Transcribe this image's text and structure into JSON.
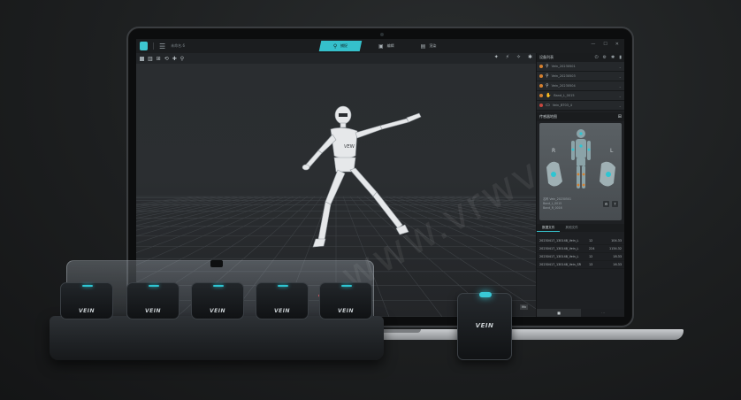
{
  "app": {
    "file_name": "未命名.6",
    "tabs": [
      {
        "label": "捕捉",
        "active": true
      },
      {
        "label": "编辑",
        "active": false
      },
      {
        "label": "渲染",
        "active": false
      }
    ]
  },
  "panel": {
    "devices_title": "设备列表",
    "devices": [
      {
        "name": "Vein_20230501",
        "status": "orange"
      },
      {
        "name": "Vein_20230503",
        "status": "orange"
      },
      {
        "name": "Vein_20230504",
        "status": "orange"
      },
      {
        "name": "Band_L_0015",
        "status": "orange"
      },
      {
        "name": "Vein_BT03_4",
        "status": "red"
      }
    ],
    "map_title": "传感器地图",
    "map_left_label": "R",
    "map_right_label": "L",
    "map_info": [
      "名称 Vein_20230501",
      "Band_L_0015",
      "Band_R_0016"
    ],
    "data_tabs": [
      {
        "label": "数据文件",
        "active": true
      },
      {
        "label": "其他文件",
        "active": false
      }
    ],
    "data_rows": [
      {
        "name": "20230417_130148_Vein_L",
        "frames": "12",
        "size": "104.33"
      },
      {
        "name": "20230417_130148_Vein_L",
        "frames": "224",
        "size": "1134.32"
      },
      {
        "name": "20230417_130148_Vein_L",
        "frames": "12",
        "size": "18.33"
      },
      {
        "name": "20230417_130148_Vein_SR",
        "frames": "13",
        "size": "16.33"
      }
    ]
  },
  "viewport": {
    "zoom_label": "Mv"
  },
  "hardware": {
    "brand": "VEIN",
    "dock_sensors": [
      "VEIN",
      "VEIN",
      "VEIN",
      "VEIN",
      "VEIN"
    ],
    "single_sensor": "VEIN"
  },
  "colors": {
    "accent": "#35c0cb",
    "status_orange": "#d6802f",
    "status_red": "#c9473f"
  },
  "watermark": "www.vrwvr.com"
}
